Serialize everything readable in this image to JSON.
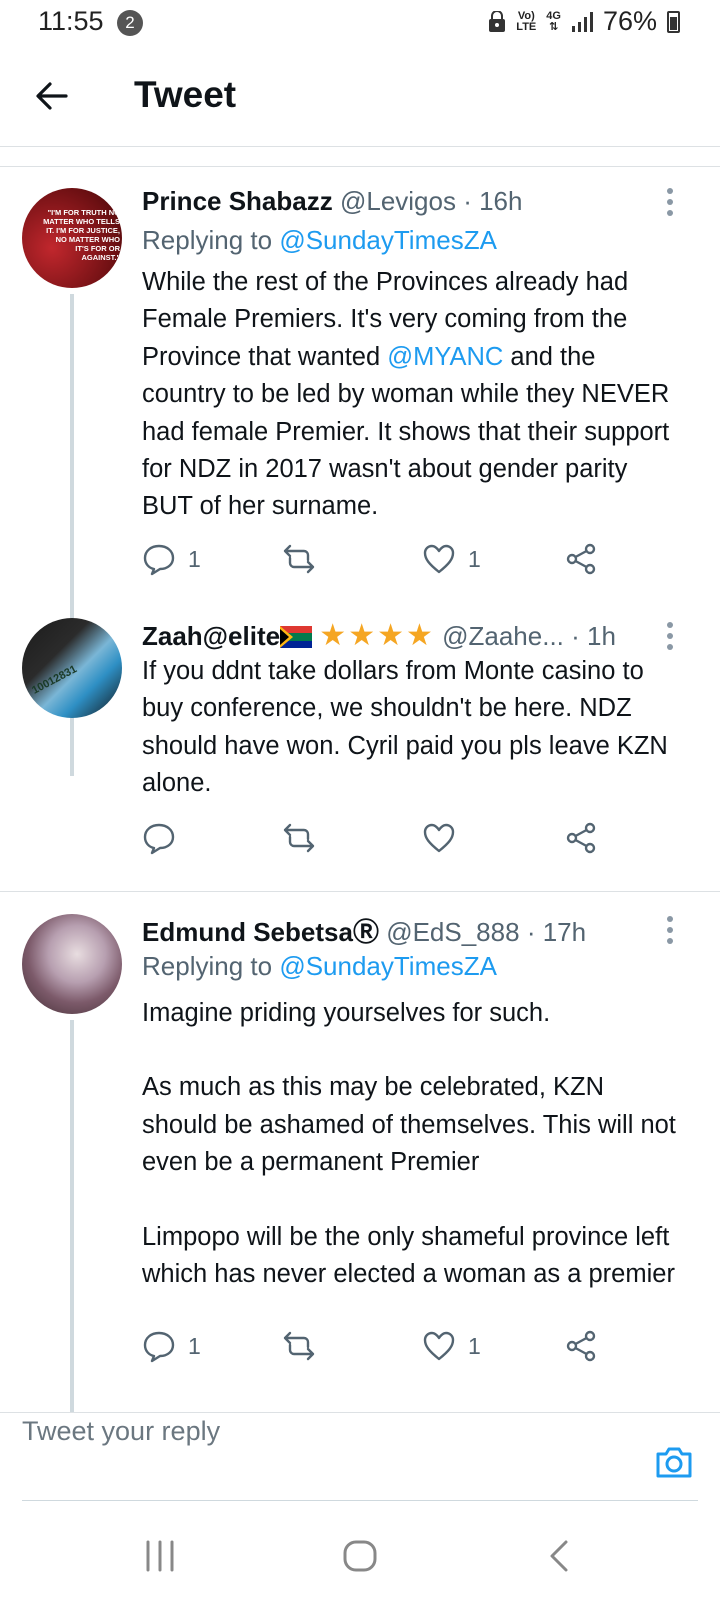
{
  "status_bar": {
    "time": "11:55",
    "notification_count": "2",
    "network_top": "Vo)",
    "network_bottom": "LTE",
    "gen": "4G",
    "battery": "76%"
  },
  "header": {
    "title": "Tweet"
  },
  "tweets": [
    {
      "name": "Prince Shabazz",
      "handle": "@Levigos",
      "time": "· 16h",
      "replying_prefix": "Replying to",
      "replying_to": "@SundayTimesZA",
      "body_parts": [
        "While the rest of the Provinces already had Female Premiers. It's very coming from the Province that wanted ",
        "@MYANC",
        " and the country to be led by woman while they NEVER had female Premier. It shows that their support for NDZ in 2017 wasn't about gender parity BUT of her surname."
      ],
      "reply_count": "1",
      "like_count": "1",
      "avatar_text": "\"I'M FOR TRUTH NO MATTER WHO TELLS IT. I'M FOR JUSTICE, NO MATTER WHO IT'S FOR OR AGAINST.\""
    },
    {
      "name": "Zaah@elite",
      "stars": "★★★★",
      "handle": "@Zaahe...",
      "time": "· 1h",
      "body": "If you ddnt take dollars from Monte casino to buy conference, we shouldn't be here. NDZ should have won. Cyril paid you pls leave KZN alone.",
      "reply_count": "",
      "like_count": "",
      "avatar_text": "10012831"
    },
    {
      "name": "Edmund Sebetsa",
      "reg": "Ⓡ",
      "handle": "@EdS_888",
      "time": "· 17h",
      "replying_prefix": "Replying to",
      "replying_to": "@SundayTimesZA",
      "body_p1": "Imagine priding yourselves for such.",
      "body_p2": "As much as this may be celebrated, KZN should be ashamed of themselves. This will not even be a permanent Premier",
      "body_p3": "Limpopo will be the only shameful province left which has never elected a woman as a premier",
      "reply_count": "1",
      "like_count": "1"
    }
  ],
  "reply_bar": {
    "placeholder": "Tweet your reply"
  },
  "colors": {
    "link": "#1d9bf0",
    "star": "#f5a623"
  }
}
